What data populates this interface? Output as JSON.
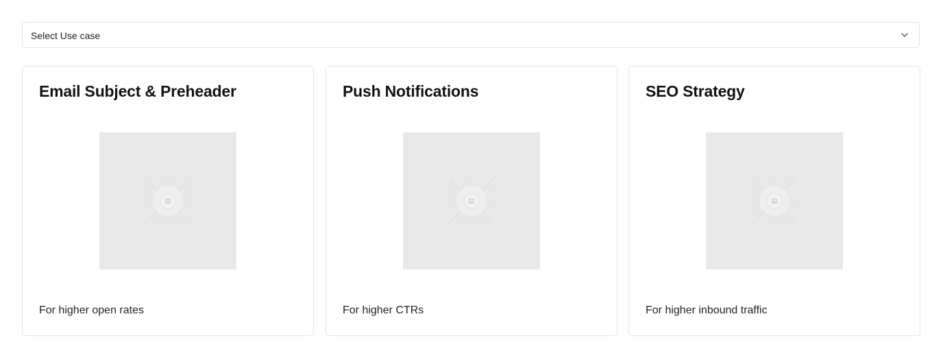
{
  "use_case_select": {
    "selected": "Select Use case",
    "icon": "chevron-down-icon"
  },
  "cards": [
    {
      "title": "Email Subject & Preheader",
      "description": "For higher open rates",
      "image_icon": "image-placeholder-icon"
    },
    {
      "title": "Push Notifications",
      "description": "For higher CTRs",
      "image_icon": "image-placeholder-icon"
    },
    {
      "title": "SEO Strategy",
      "description": "For higher inbound traffic",
      "image_icon": "image-placeholder-icon"
    }
  ],
  "colors": {
    "border": "#e4e4e4",
    "placeholder_bg": "#e8e8e8",
    "text": "#121212"
  }
}
